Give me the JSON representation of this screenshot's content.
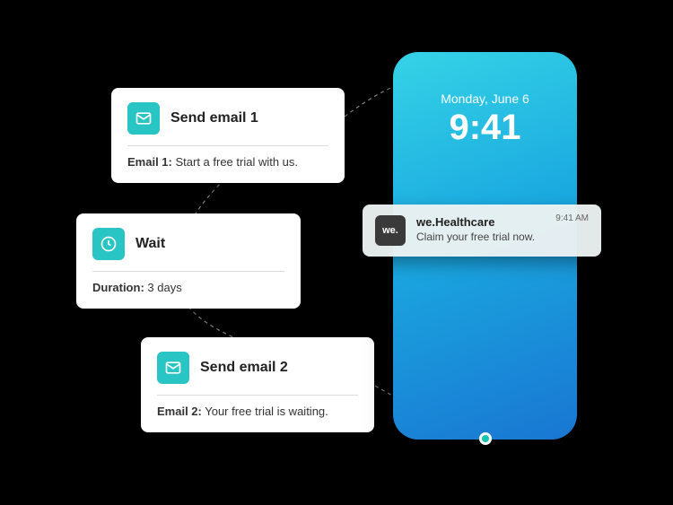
{
  "workflow": {
    "email1": {
      "title": "Send email 1",
      "body_label": "Email 1:",
      "body_text": " Start a free trial with us."
    },
    "wait": {
      "title": "Wait",
      "body_label": "Duration:",
      "body_text": " 3 days"
    },
    "email2": {
      "title": "Send email 2",
      "body_label": "Email 2:",
      "body_text": " Your free trial is waiting."
    }
  },
  "phone": {
    "date": "Monday, June 6",
    "time": "9:41",
    "notification": {
      "app_icon_text": "we.",
      "app_name": "we.Healthcare",
      "message": "Claim your free trial now.",
      "timestamp": "9:41 AM"
    }
  }
}
